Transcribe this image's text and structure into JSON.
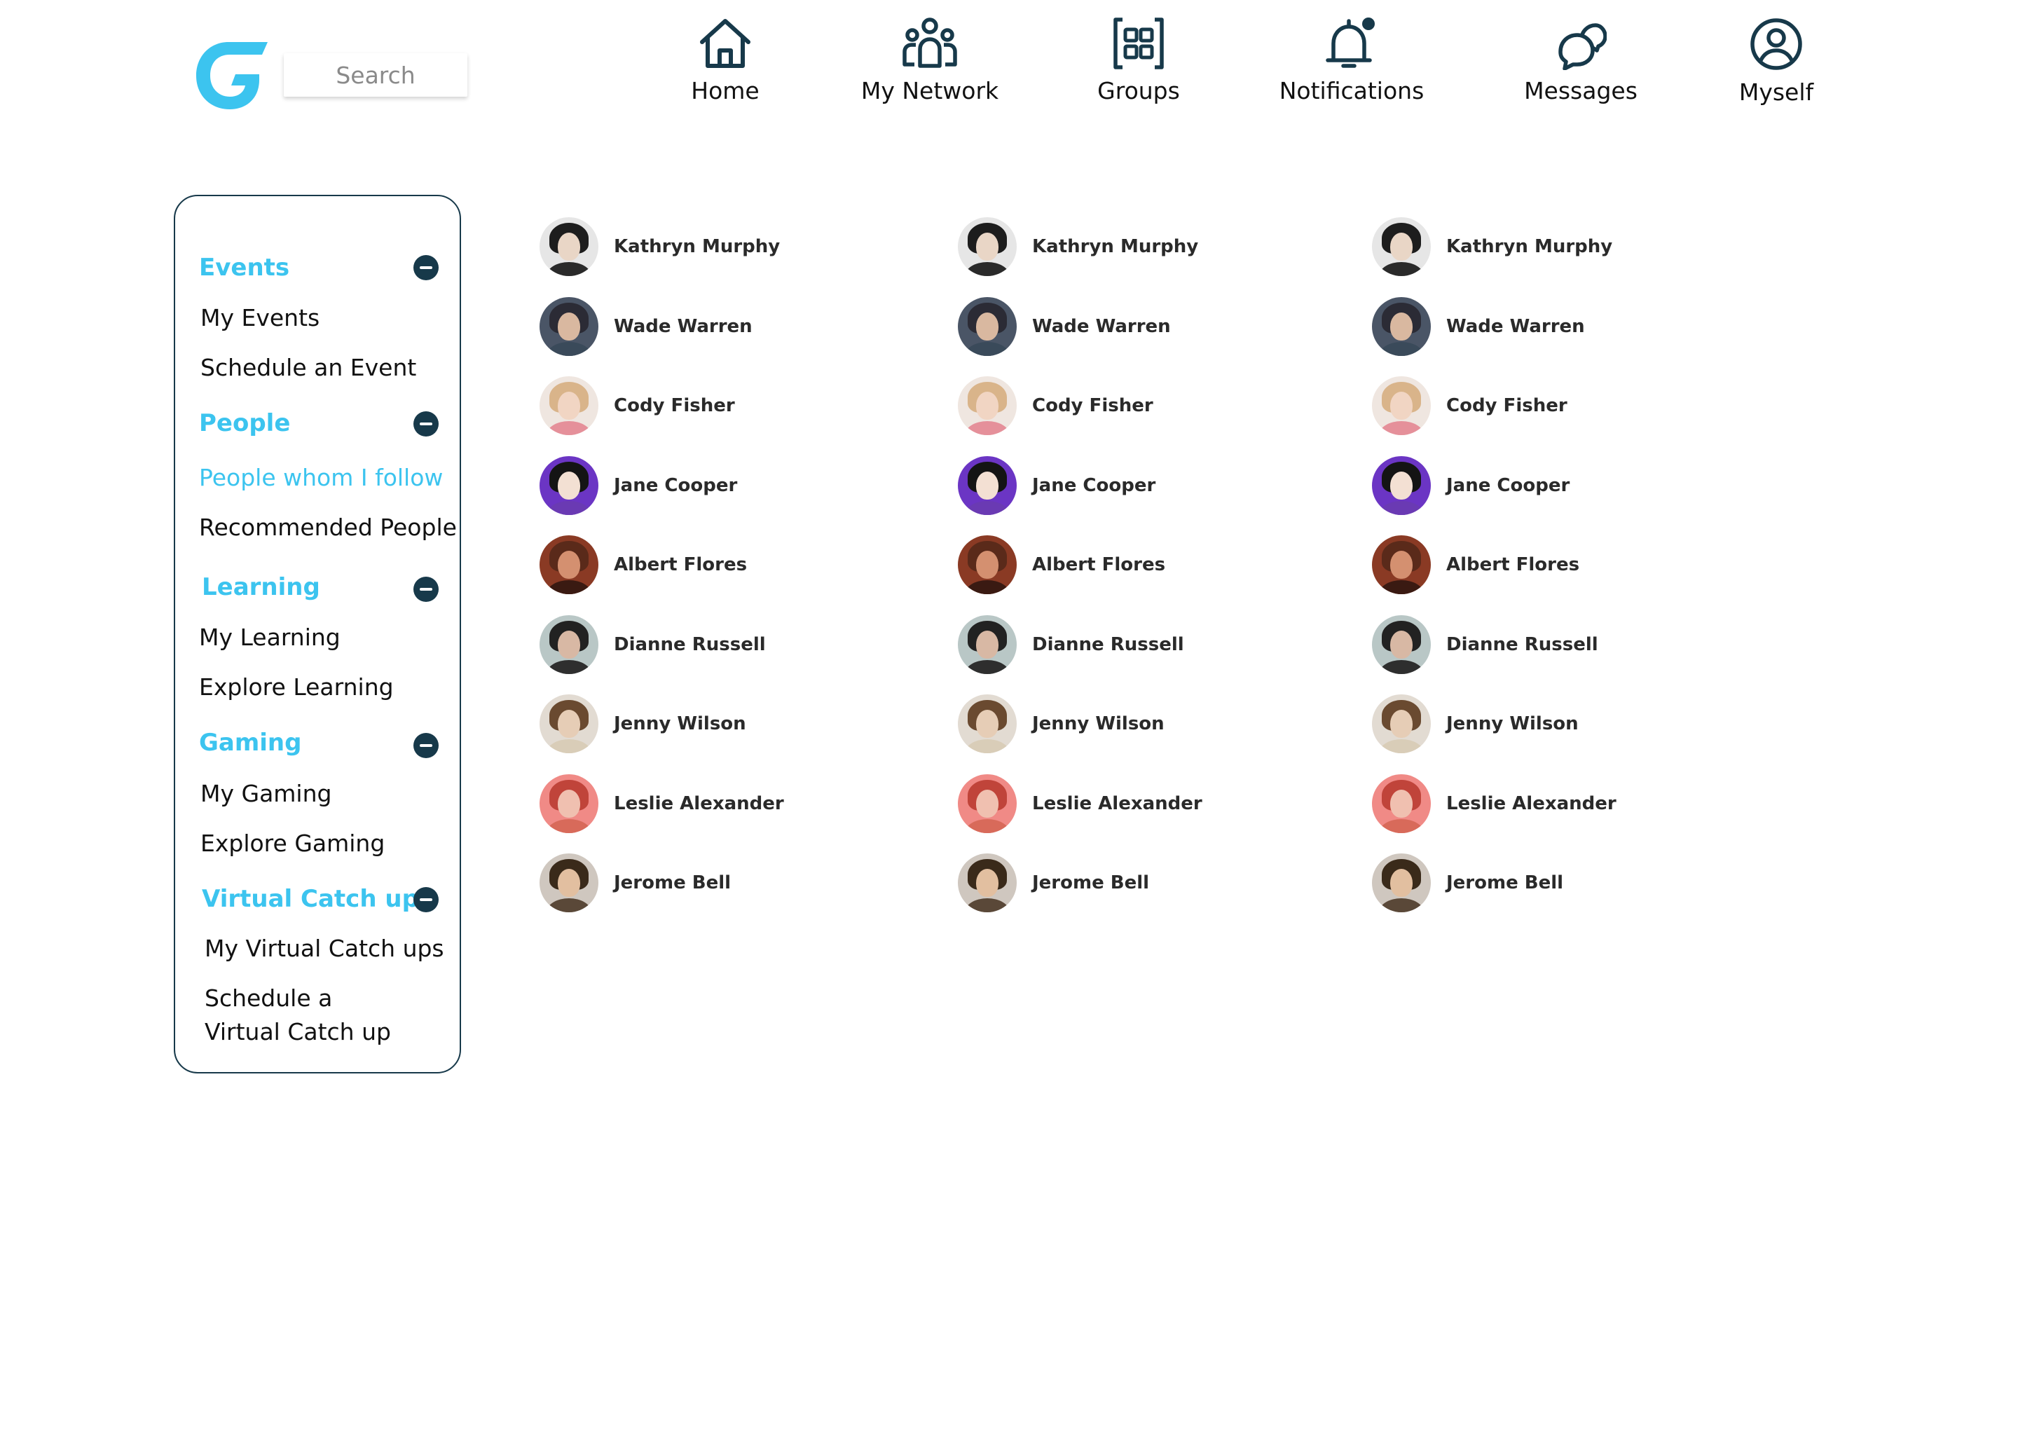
{
  "search": {
    "placeholder": "Search"
  },
  "nav": [
    {
      "label": "Home",
      "icon": "home-icon"
    },
    {
      "label": "My Network",
      "icon": "network-icon"
    },
    {
      "label": "Groups",
      "icon": "groups-icon"
    },
    {
      "label": "Notifications",
      "icon": "bell-icon"
    },
    {
      "label": "Messages",
      "icon": "chat-icon"
    },
    {
      "label": "Myself",
      "icon": "user-circle-icon"
    }
  ],
  "sidebar": {
    "sections": [
      {
        "title": "Events",
        "items": [
          "My Events",
          "Schedule an Event"
        ]
      },
      {
        "title": "People",
        "items": [
          "People whom I follow",
          "Recommended People"
        ]
      },
      {
        "title": "Learning",
        "items": [
          "My Learning",
          "Explore Learning"
        ]
      },
      {
        "title": "Gaming",
        "items": [
          "My Gaming",
          "Explore Gaming"
        ]
      },
      {
        "title": "Virtual Catch ups",
        "items": [
          "My Virtual Catch ups",
          "Schedule a Virtual Catch up"
        ]
      }
    ],
    "active_item": "People whom I follow"
  },
  "people": [
    [
      "Kathryn Murphy",
      "Wade Warren",
      "Cody Fisher",
      "Jane Cooper",
      "Albert Flores",
      "Dianne Russell",
      "Jenny Wilson",
      "Leslie Alexander",
      "Jerome Bell"
    ],
    [
      "Kathryn Murphy",
      "Wade Warren",
      "Cody Fisher",
      "Jane Cooper",
      "Albert Flores",
      "Dianne Russell",
      "Jenny Wilson",
      "Leslie Alexander",
      "Jerome Bell"
    ],
    [
      "Kathryn Murphy",
      "Wade Warren",
      "Cody Fisher",
      "Jane Cooper",
      "Albert Flores",
      "Dianne Russell",
      "Jenny Wilson",
      "Leslie Alexander",
      "Jerome Bell"
    ]
  ],
  "colors": {
    "accent": "#3cc4ef",
    "dark": "#17394a",
    "notification_dot": "#17394a"
  }
}
